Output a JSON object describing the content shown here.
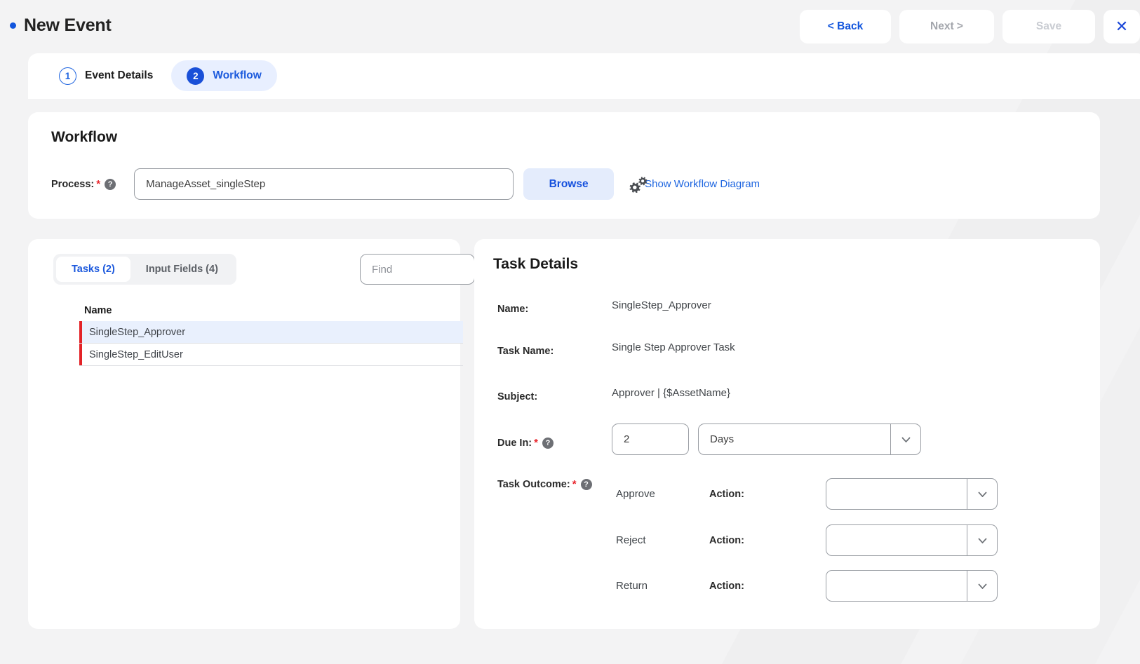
{
  "header": {
    "title": "New Event",
    "status_dot_color": "#1155dd",
    "buttons": {
      "back": "< Back",
      "next": "Next >",
      "save": "Save",
      "close": "✕"
    }
  },
  "steps": [
    {
      "num": "1",
      "label": "Event Details",
      "active": false
    },
    {
      "num": "2",
      "label": "Workflow",
      "active": true
    }
  ],
  "workflow": {
    "heading": "Workflow",
    "process_label": "Process:",
    "process_value": "ManageAsset_singleStep",
    "browse_label": "Browse",
    "diagram_link": "Show Workflow Diagram"
  },
  "left_panel": {
    "tabs": [
      {
        "label": "Tasks (2)",
        "selected": true
      },
      {
        "label": "Input Fields (4)",
        "selected": false
      }
    ],
    "find_placeholder": "Find",
    "column_header": "Name",
    "rows": [
      {
        "name": "SingleStep_Approver",
        "selected": true
      },
      {
        "name": "SingleStep_EditUser",
        "selected": false
      }
    ]
  },
  "task_details": {
    "heading": "Task Details",
    "name_label": "Name:",
    "name_value": "SingleStep_Approver",
    "task_name_label": "Task Name:",
    "task_name_value": "Single Step Approver Task",
    "subject_label": "Subject:",
    "subject_value": "Approver | {$AssetName}",
    "due_in_label": "Due In:",
    "due_in_value": "2",
    "due_in_unit": "Days",
    "task_outcome_label": "Task Outcome:",
    "outcomes": [
      {
        "name": "Approve",
        "action_label": "Action:",
        "action_value": ""
      },
      {
        "name": "Reject",
        "action_label": "Action:",
        "action_value": ""
      },
      {
        "name": "Return",
        "action_label": "Action:",
        "action_value": ""
      }
    ]
  },
  "colors": {
    "accent_blue": "#1550dd",
    "link_blue": "#1f66e0",
    "required_red": "#e8242b",
    "row_marker_red": "#e32227",
    "selected_row_bg": "#e9f0fd",
    "page_bg": "#f3f3f4"
  }
}
